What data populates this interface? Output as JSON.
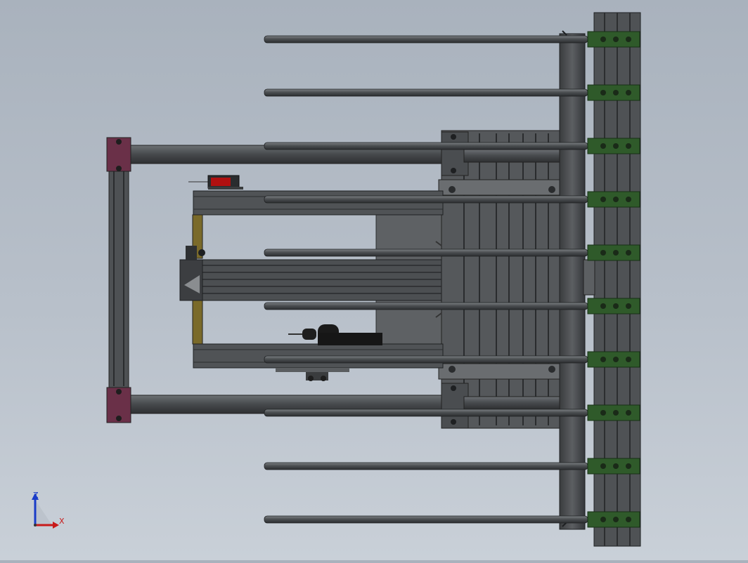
{
  "view": {
    "triad": {
      "z_label": "Z",
      "x_label": "X"
    },
    "colors": {
      "background_top": "#a9b2bd",
      "background_bottom": "#c9d0d8",
      "steel": "#5a5d60",
      "steel_dark": "#3a3c3e",
      "steel_light": "#8a8d90",
      "bracket_green": "#2f5a2a",
      "bracket_maroon": "#6a3048",
      "brass": "#7a6a2a",
      "sensor_red": "#b01010",
      "axis_z": "#1a3cc8",
      "axis_x": "#c81a1a"
    },
    "icons": [
      "triad-axes-icon"
    ]
  }
}
